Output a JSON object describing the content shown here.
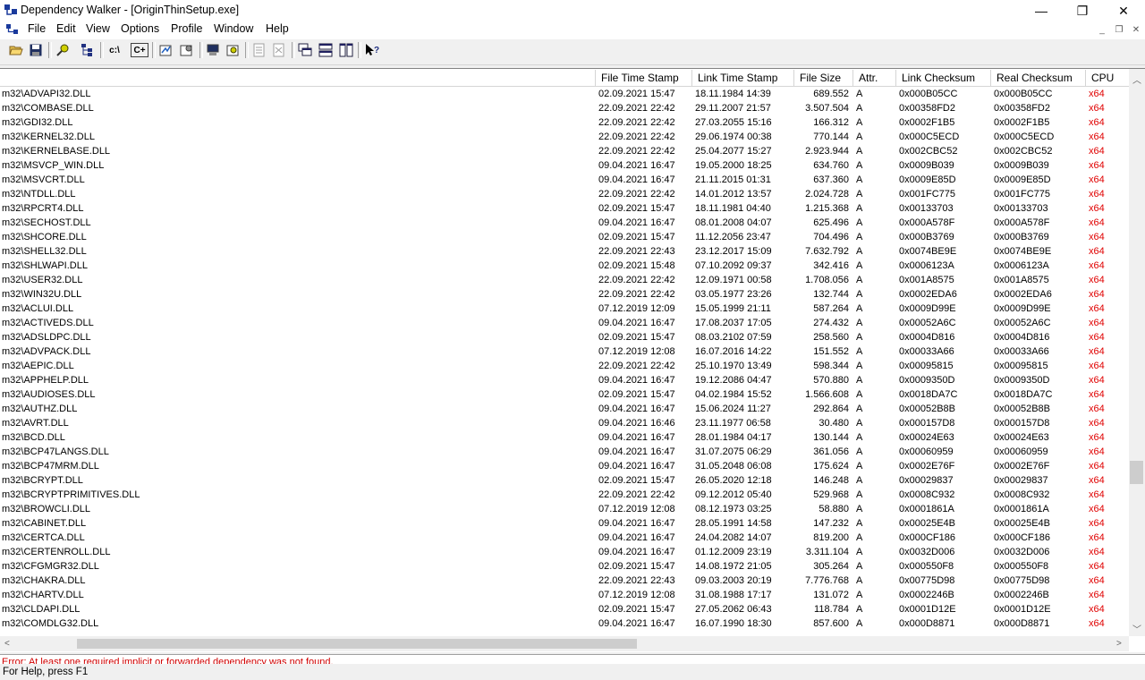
{
  "window": {
    "title": "Dependency Walker - [OriginThinSetup.exe]",
    "controls": [
      "—",
      "❐",
      "✕"
    ]
  },
  "menu": [
    "File",
    "Edit",
    "View",
    "Options",
    "Profile",
    "Window",
    "Help"
  ],
  "mdi_controls": [
    "_",
    "❐",
    "✕"
  ],
  "toolbar": [
    {
      "icon": "open-folder-icon"
    },
    {
      "icon": "save-icon"
    },
    {
      "sep": true
    },
    {
      "icon": "find-icon"
    },
    {
      "icon": "copy-tree-icon"
    },
    {
      "sep": true
    },
    {
      "icon": "full-paths-icon",
      "text": "c:\\"
    },
    {
      "icon": "undecorate-cpp-icon",
      "text": "C+"
    },
    {
      "sep": true
    },
    {
      "icon": "auto-expand-icon"
    },
    {
      "icon": "properties-icon"
    },
    {
      "sep": true
    },
    {
      "icon": "system-info-icon"
    },
    {
      "icon": "search-file-icon"
    },
    {
      "sep": true
    },
    {
      "icon": "highlight-matching-icon"
    },
    {
      "icon": "highlight-original-icon"
    },
    {
      "sep": true
    },
    {
      "icon": "cascade-icon"
    },
    {
      "icon": "tile-horizontal-icon"
    },
    {
      "icon": "tile-vertical-icon"
    },
    {
      "sep": true
    },
    {
      "icon": "context-help-icon"
    }
  ],
  "columns": [
    "File Time Stamp",
    "Link Time Stamp",
    "File Size",
    "Attr.",
    "Link Checksum",
    "Real Checksum",
    "CPU"
  ],
  "rows": [
    [
      "m32\\ADVAPI32.DLL",
      "02.09.2021 15:47",
      "18.11.1984 14:39",
      "689.552",
      "A",
      "0x000B05CC",
      "0x000B05CC",
      "x64"
    ],
    [
      "m32\\COMBASE.DLL",
      "22.09.2021 22:42",
      "29.11.2007 21:57",
      "3.507.504",
      "A",
      "0x00358FD2",
      "0x00358FD2",
      "x64"
    ],
    [
      "m32\\GDI32.DLL",
      "22.09.2021 22:42",
      "27.03.2055 15:16",
      "166.312",
      "A",
      "0x0002F1B5",
      "0x0002F1B5",
      "x64"
    ],
    [
      "m32\\KERNEL32.DLL",
      "22.09.2021 22:42",
      "29.06.1974 00:38",
      "770.144",
      "A",
      "0x000C5ECD",
      "0x000C5ECD",
      "x64"
    ],
    [
      "m32\\KERNELBASE.DLL",
      "22.09.2021 22:42",
      "25.04.2077 15:27",
      "2.923.944",
      "A",
      "0x002CBC52",
      "0x002CBC52",
      "x64"
    ],
    [
      "m32\\MSVCP_WIN.DLL",
      "09.04.2021 16:47",
      "19.05.2000 18:25",
      "634.760",
      "A",
      "0x0009B039",
      "0x0009B039",
      "x64"
    ],
    [
      "m32\\MSVCRT.DLL",
      "09.04.2021 16:47",
      "21.11.2015 01:31",
      "637.360",
      "A",
      "0x0009E85D",
      "0x0009E85D",
      "x64"
    ],
    [
      "m32\\NTDLL.DLL",
      "22.09.2021 22:42",
      "14.01.2012 13:57",
      "2.024.728",
      "A",
      "0x001FC775",
      "0x001FC775",
      "x64"
    ],
    [
      "m32\\RPCRT4.DLL",
      "02.09.2021 15:47",
      "18.11.1981 04:40",
      "1.215.368",
      "A",
      "0x00133703",
      "0x00133703",
      "x64"
    ],
    [
      "m32\\SECHOST.DLL",
      "09.04.2021 16:47",
      "08.01.2008 04:07",
      "625.496",
      "A",
      "0x000A578F",
      "0x000A578F",
      "x64"
    ],
    [
      "m32\\SHCORE.DLL",
      "02.09.2021 15:47",
      "11.12.2056 23:47",
      "704.496",
      "A",
      "0x000B3769",
      "0x000B3769",
      "x64"
    ],
    [
      "m32\\SHELL32.DLL",
      "22.09.2021 22:43",
      "23.12.2017 15:09",
      "7.632.792",
      "A",
      "0x0074BE9E",
      "0x0074BE9E",
      "x64"
    ],
    [
      "m32\\SHLWAPI.DLL",
      "02.09.2021 15:48",
      "07.10.2092 09:37",
      "342.416",
      "A",
      "0x0006123A",
      "0x0006123A",
      "x64"
    ],
    [
      "m32\\USER32.DLL",
      "22.09.2021 22:42",
      "12.09.1971 00:58",
      "1.708.056",
      "A",
      "0x001A8575",
      "0x001A8575",
      "x64"
    ],
    [
      "m32\\WIN32U.DLL",
      "22.09.2021 22:42",
      "03.05.1977 23:26",
      "132.744",
      "A",
      "0x0002EDA6",
      "0x0002EDA6",
      "x64"
    ],
    [
      "m32\\ACLUI.DLL",
      "07.12.2019 12:09",
      "15.05.1999 21:11",
      "587.264",
      "A",
      "0x0009D99E",
      "0x0009D99E",
      "x64"
    ],
    [
      "m32\\ACTIVEDS.DLL",
      "09.04.2021 16:47",
      "17.08.2037 17:05",
      "274.432",
      "A",
      "0x00052A6C",
      "0x00052A6C",
      "x64"
    ],
    [
      "m32\\ADSLDPC.DLL",
      "02.09.2021 15:47",
      "08.03.2102 07:59",
      "258.560",
      "A",
      "0x0004D816",
      "0x0004D816",
      "x64"
    ],
    [
      "m32\\ADVPACK.DLL",
      "07.12.2019 12:08",
      "16.07.2016 14:22",
      "151.552",
      "A",
      "0x00033A66",
      "0x00033A66",
      "x64"
    ],
    [
      "m32\\AEPIC.DLL",
      "22.09.2021 22:42",
      "25.10.1970 13:49",
      "598.344",
      "A",
      "0x00095815",
      "0x00095815",
      "x64"
    ],
    [
      "m32\\APPHELP.DLL",
      "09.04.2021 16:47",
      "19.12.2086 04:47",
      "570.880",
      "A",
      "0x0009350D",
      "0x0009350D",
      "x64"
    ],
    [
      "m32\\AUDIOSES.DLL",
      "02.09.2021 15:47",
      "04.02.1984 15:52",
      "1.566.608",
      "A",
      "0x0018DA7C",
      "0x0018DA7C",
      "x64"
    ],
    [
      "m32\\AUTHZ.DLL",
      "09.04.2021 16:47",
      "15.06.2024 11:27",
      "292.864",
      "A",
      "0x00052B8B",
      "0x00052B8B",
      "x64"
    ],
    [
      "m32\\AVRT.DLL",
      "09.04.2021 16:46",
      "23.11.1977 06:58",
      "30.480",
      "A",
      "0x000157D8",
      "0x000157D8",
      "x64"
    ],
    [
      "m32\\BCD.DLL",
      "09.04.2021 16:47",
      "28.01.1984 04:17",
      "130.144",
      "A",
      "0x00024E63",
      "0x00024E63",
      "x64"
    ],
    [
      "m32\\BCP47LANGS.DLL",
      "09.04.2021 16:47",
      "31.07.2075 06:29",
      "361.056",
      "A",
      "0x00060959",
      "0x00060959",
      "x64"
    ],
    [
      "m32\\BCP47MRM.DLL",
      "09.04.2021 16:47",
      "31.05.2048 06:08",
      "175.624",
      "A",
      "0x0002E76F",
      "0x0002E76F",
      "x64"
    ],
    [
      "m32\\BCRYPT.DLL",
      "02.09.2021 15:47",
      "26.05.2020 12:18",
      "146.248",
      "A",
      "0x00029837",
      "0x00029837",
      "x64"
    ],
    [
      "m32\\BCRYPTPRIMITIVES.DLL",
      "22.09.2021 22:42",
      "09.12.2012 05:40",
      "529.968",
      "A",
      "0x0008C932",
      "0x0008C932",
      "x64"
    ],
    [
      "m32\\BROWCLI.DLL",
      "07.12.2019 12:08",
      "08.12.1973 03:25",
      "58.880",
      "A",
      "0x0001861A",
      "0x0001861A",
      "x64"
    ],
    [
      "m32\\CABINET.DLL",
      "09.04.2021 16:47",
      "28.05.1991 14:58",
      "147.232",
      "A",
      "0x00025E4B",
      "0x00025E4B",
      "x64"
    ],
    [
      "m32\\CERTCA.DLL",
      "09.04.2021 16:47",
      "24.04.2082 14:07",
      "819.200",
      "A",
      "0x000CF186",
      "0x000CF186",
      "x64"
    ],
    [
      "m32\\CERTENROLL.DLL",
      "09.04.2021 16:47",
      "01.12.2009 23:19",
      "3.311.104",
      "A",
      "0x0032D006",
      "0x0032D006",
      "x64"
    ],
    [
      "m32\\CFGMGR32.DLL",
      "02.09.2021 15:47",
      "14.08.1972 21:05",
      "305.264",
      "A",
      "0x000550F8",
      "0x000550F8",
      "x64"
    ],
    [
      "m32\\CHAKRA.DLL",
      "22.09.2021 22:43",
      "09.03.2003 20:19",
      "7.776.768",
      "A",
      "0x00775D98",
      "0x00775D98",
      "x64"
    ],
    [
      "m32\\CHARTV.DLL",
      "07.12.2019 12:08",
      "31.08.1988 17:17",
      "131.072",
      "A",
      "0x0002246B",
      "0x0002246B",
      "x64"
    ],
    [
      "m32\\CLDAPI.DLL",
      "02.09.2021 15:47",
      "27.05.2062 06:43",
      "118.784",
      "A",
      "0x0001D12E",
      "0x0001D12E",
      "x64"
    ],
    [
      "m32\\COMDLG32.DLL",
      "09.04.2021 16:47",
      "16.07.1990 18:30",
      "857.600",
      "A",
      "0x000D8871",
      "0x000D8871",
      "x64"
    ]
  ],
  "log_text": "Error: At least one required implicit or forwarded dependency was not found.",
  "status": "For Help, press F1"
}
